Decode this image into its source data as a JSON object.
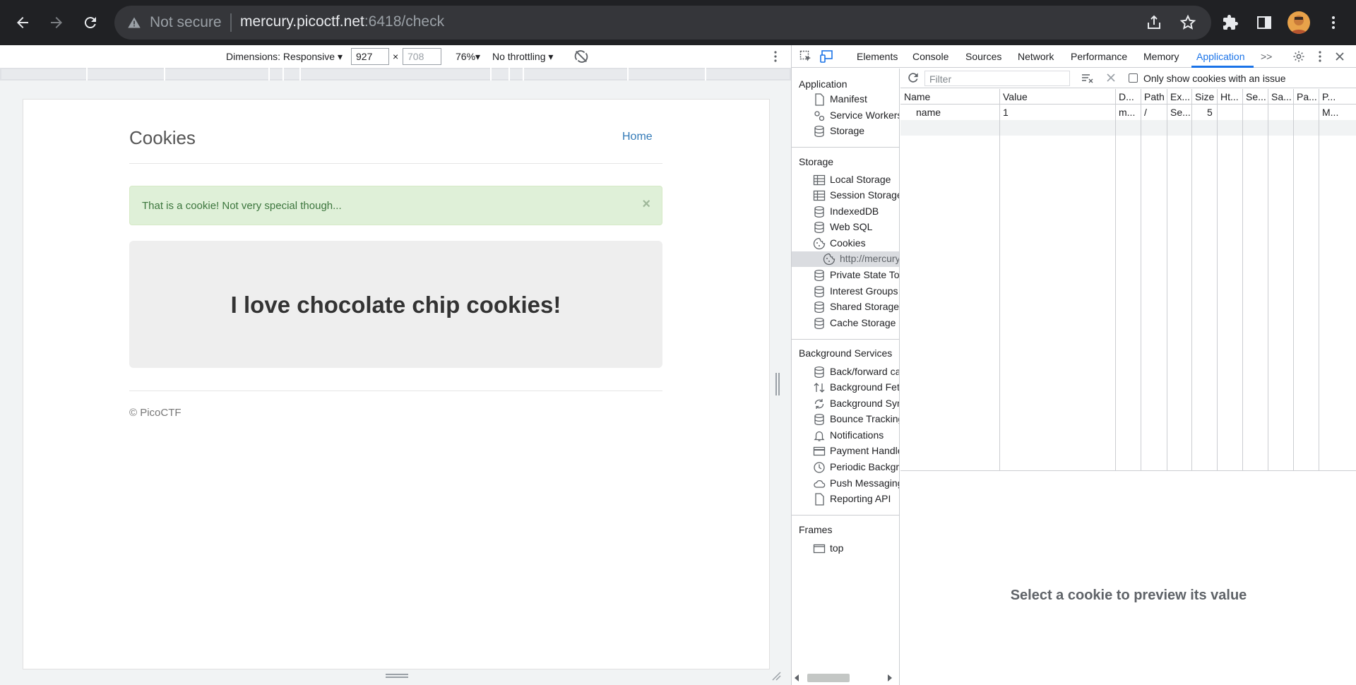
{
  "browser": {
    "security_label": "Not secure",
    "url_host": "mercury.picoctf.net",
    "url_path": ":6418/check"
  },
  "device_toolbar": {
    "dimensions_label": "Dimensions: Responsive",
    "width_value": "927",
    "times": "×",
    "height_placeholder": "708",
    "zoom_label": "76%",
    "throttle_label": "No throttling"
  },
  "page": {
    "site_title": "Cookies",
    "home_link": "Home",
    "alert_text": "That is a cookie! Not very special though...",
    "alert_close": "×",
    "jumbotron_text": "I love chocolate chip cookies!",
    "footer_text": "© PicoCTF"
  },
  "devtools": {
    "tabs": [
      "Elements",
      "Console",
      "Sources",
      "Network",
      "Performance",
      "Memory",
      "Application"
    ],
    "more_tabs": ">>",
    "sidebar": {
      "application_header": "Application",
      "application_items": [
        "Manifest",
        "Service Workers",
        "Storage"
      ],
      "storage_header": "Storage",
      "storage_items": [
        "Local Storage",
        "Session Storage",
        "IndexedDB",
        "Web SQL",
        "Cookies",
        "http://mercury",
        "Private State Tok",
        "Interest Groups",
        "Shared Storage",
        "Cache Storage"
      ],
      "background_header": "Background Services",
      "background_items": [
        "Back/forward ca",
        "Background Fetc",
        "Background Syn",
        "Bounce Tracking",
        "Notifications",
        "Payment Handle",
        "Periodic Backgro",
        "Push Messaging",
        "Reporting API"
      ],
      "frames_header": "Frames",
      "frames_items": [
        "top"
      ]
    },
    "cookies": {
      "filter_placeholder": "Filter",
      "only_issue_label": "Only show cookies with an issue",
      "columns": [
        "Name",
        "Value",
        "D...",
        "Path",
        "Ex...",
        "Size",
        "Ht...",
        "Se...",
        "Sa...",
        "Pa...",
        "P..."
      ],
      "rows": [
        [
          "name",
          "1",
          "m...",
          "/",
          "Se...",
          "5",
          "",
          "",
          "",
          "",
          "M..."
        ]
      ],
      "preview_message": "Select a cookie to preview its value"
    }
  }
}
